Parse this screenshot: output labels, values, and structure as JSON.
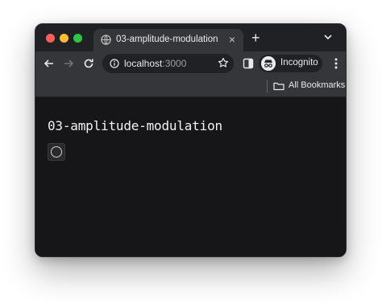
{
  "tab": {
    "title": "03-amplitude-modulation",
    "close_glyph": "×"
  },
  "new_tab_glyph": "+",
  "omnibox": {
    "host": "localhost",
    "port": ":3000"
  },
  "profile": {
    "label": "Incognito"
  },
  "bookmarks": {
    "label": "All Bookmarks"
  },
  "page": {
    "heading": "03-amplitude-modulation"
  },
  "colors": {
    "page_bg": "#161618",
    "chrome_bg": "#35363a",
    "strip_bg": "#202124"
  }
}
